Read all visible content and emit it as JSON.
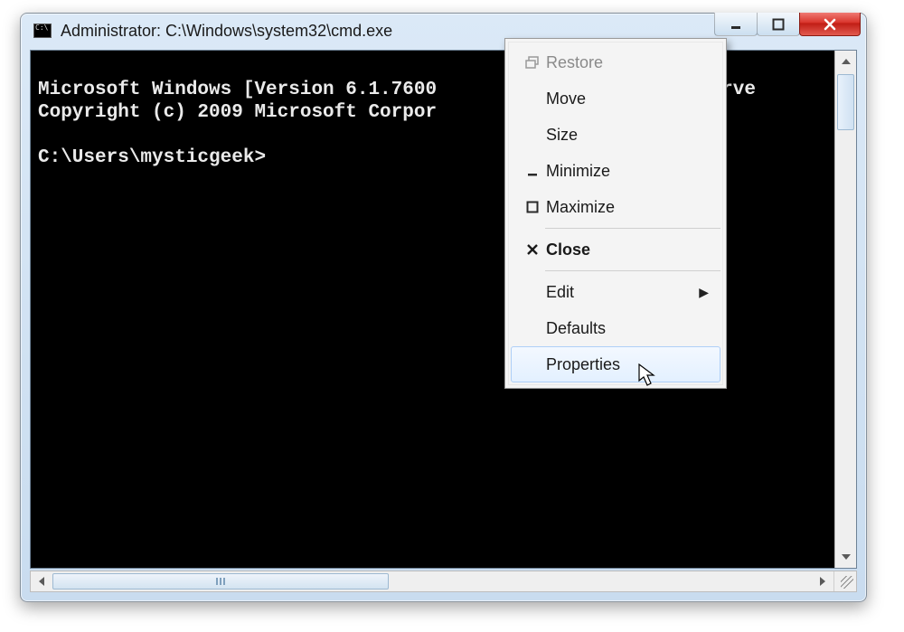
{
  "window": {
    "title": "Administrator: C:\\Windows\\system32\\cmd.exe"
  },
  "console": {
    "line1": "Microsoft Windows [Version 6.1.7600",
    "line1_right": "reserve",
    "line2": "Copyright (c) 2009 Microsoft Corpor",
    "prompt": "C:\\Users\\mysticgeek>"
  },
  "menu": {
    "restore": "Restore",
    "move": "Move",
    "size": "Size",
    "minimize": "Minimize",
    "maximize": "Maximize",
    "close": "Close",
    "edit": "Edit",
    "defaults": "Defaults",
    "properties": "Properties"
  }
}
